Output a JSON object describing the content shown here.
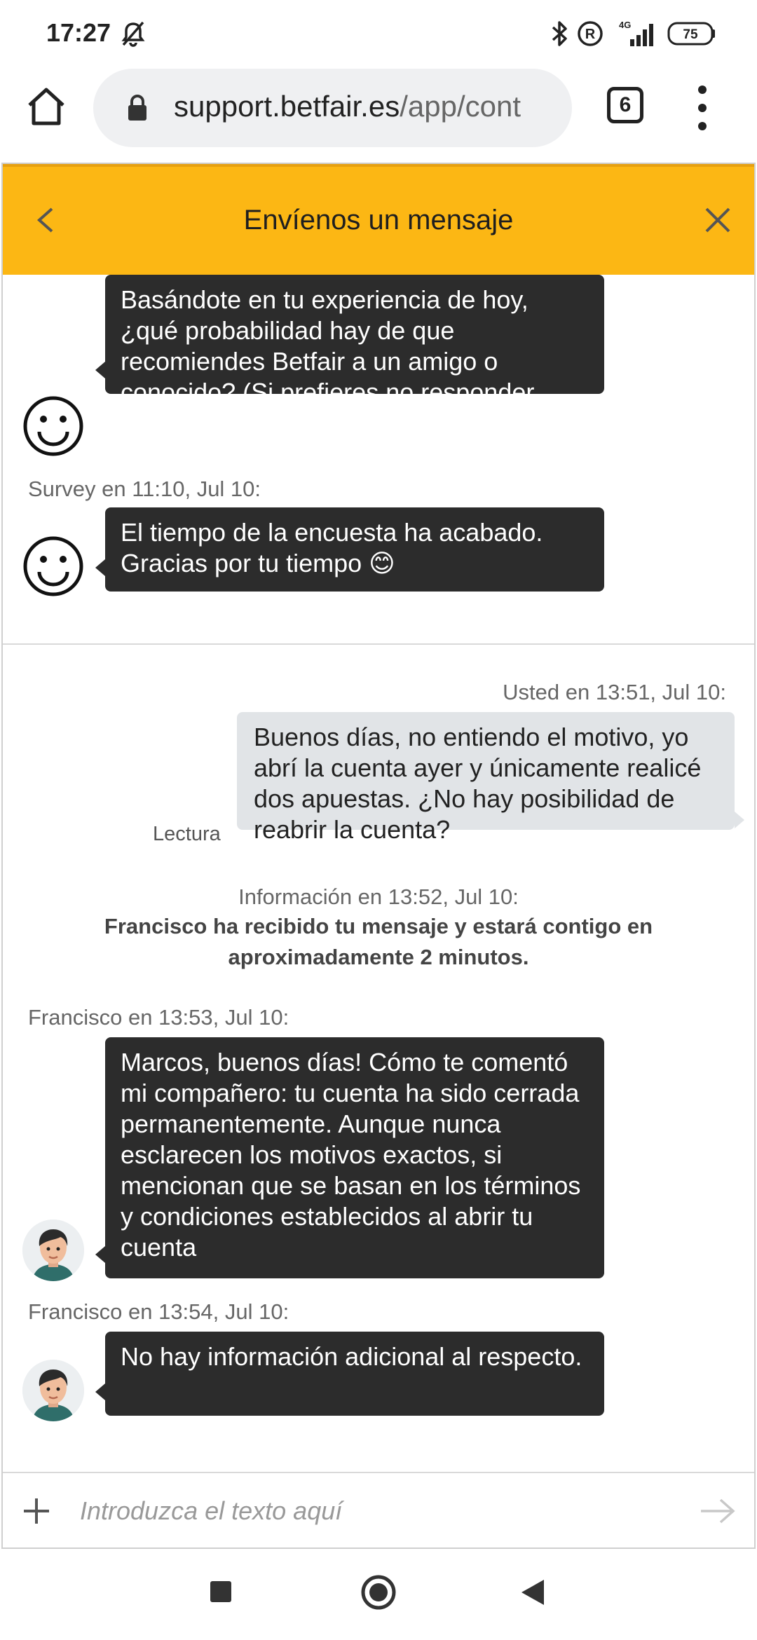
{
  "status_bar": {
    "time": "17:27",
    "network": "4G",
    "battery": "75"
  },
  "browser": {
    "url_host": "support.betfair.es",
    "url_path": "/app/cont",
    "tab_count": "6"
  },
  "chat": {
    "title": "Envíenos un mensaje",
    "messages": [
      {
        "type": "survey",
        "text": "Basándote en tu experiencia de hoy, ¿qué probabilidad hay de que recomiendes Betfair a un amigo o conocido? (Si prefieres no responder, escribe ‘pasar’ debajo)."
      },
      {
        "type": "survey",
        "meta": "Survey en 11:10, Jul 10:",
        "text": "El tiempo de la encuesta ha acabado. Gracias por tu tiempo 😊"
      },
      {
        "type": "user",
        "meta": "Usted en 13:51, Jul 10:",
        "text": "Buenos días, no entiendo el motivo, yo abrí la cuenta ayer y únicamente realicé dos apuestas. ¿No hay posibilidad de reabrir la cuenta?",
        "read_label": "Lectura"
      },
      {
        "type": "info",
        "meta": "Información en 13:52, Jul 10:",
        "text": "Francisco ha recibido tu mensaje y estará contigo en aproximadamente 2 minutos."
      },
      {
        "type": "agent",
        "meta": "Francisco en 13:53, Jul 10:",
        "text": "Marcos, buenos días! Cómo te comentó mi compañero: tu cuenta ha sido cerrada permanentemente. Aunque nunca esclarecen los motivos exactos, si mencionan que se basan en los términos y condiciones establecidos al abrir tu cuenta"
      },
      {
        "type": "agent",
        "meta": "Francisco en 13:54, Jul 10:",
        "text": "No hay información adicional al respecto."
      }
    ],
    "input_placeholder": "Introduzca el texto aquí"
  },
  "colors": {
    "header_bg": "#fcb714",
    "bubble_dark": "#2c2c2c",
    "bubble_user": "#e1e4e7"
  }
}
